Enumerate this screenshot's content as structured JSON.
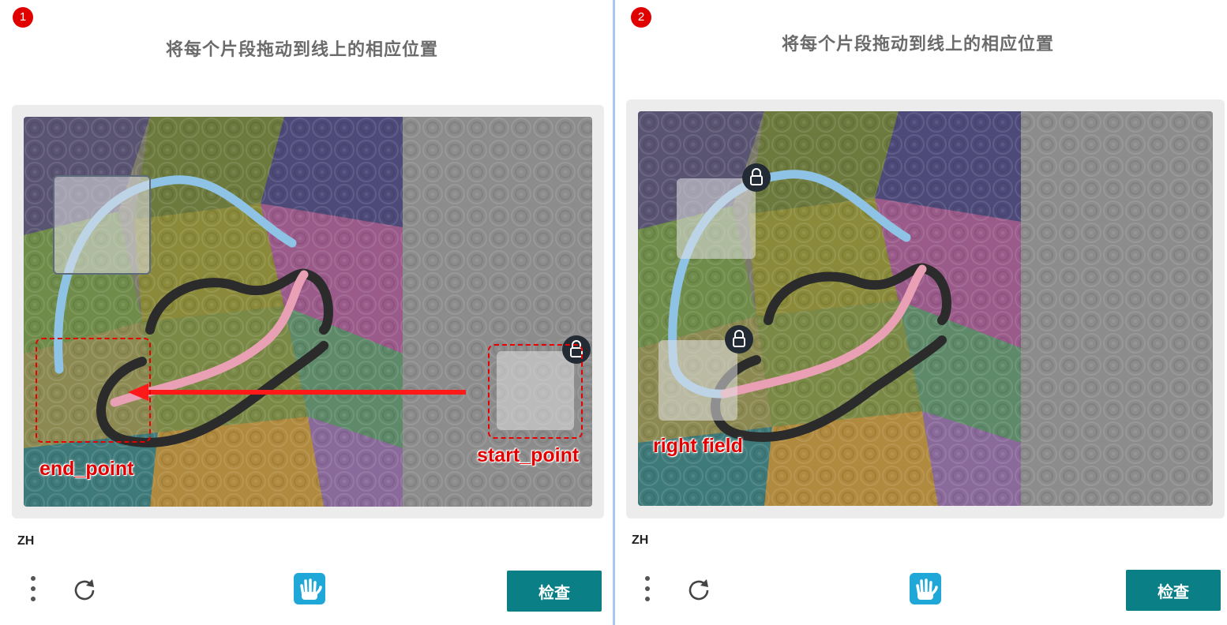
{
  "panels": [
    {
      "step": "1",
      "title": "将每个片段拖动到线上的相应位置",
      "lang": "ZH",
      "check_button": "检查",
      "annotations": {
        "end_label": "end_point",
        "start_label": "start_point"
      }
    },
    {
      "step": "2",
      "title": "将每个片段拖动到线上的相应位置",
      "lang": "ZH",
      "check_button": "检查",
      "annotations": {
        "field_label": "right field"
      }
    }
  ],
  "icons": {
    "menu": "vertical-dots-icon",
    "refresh": "refresh-icon",
    "logo": "hand-logo-icon",
    "lock": "lock-icon",
    "arrow": "drag-arrow-icon"
  },
  "colors": {
    "button": "#0b7f86",
    "annotation": "#e30000",
    "divider": "#a9c6f5",
    "step_badge": "#e00000"
  }
}
